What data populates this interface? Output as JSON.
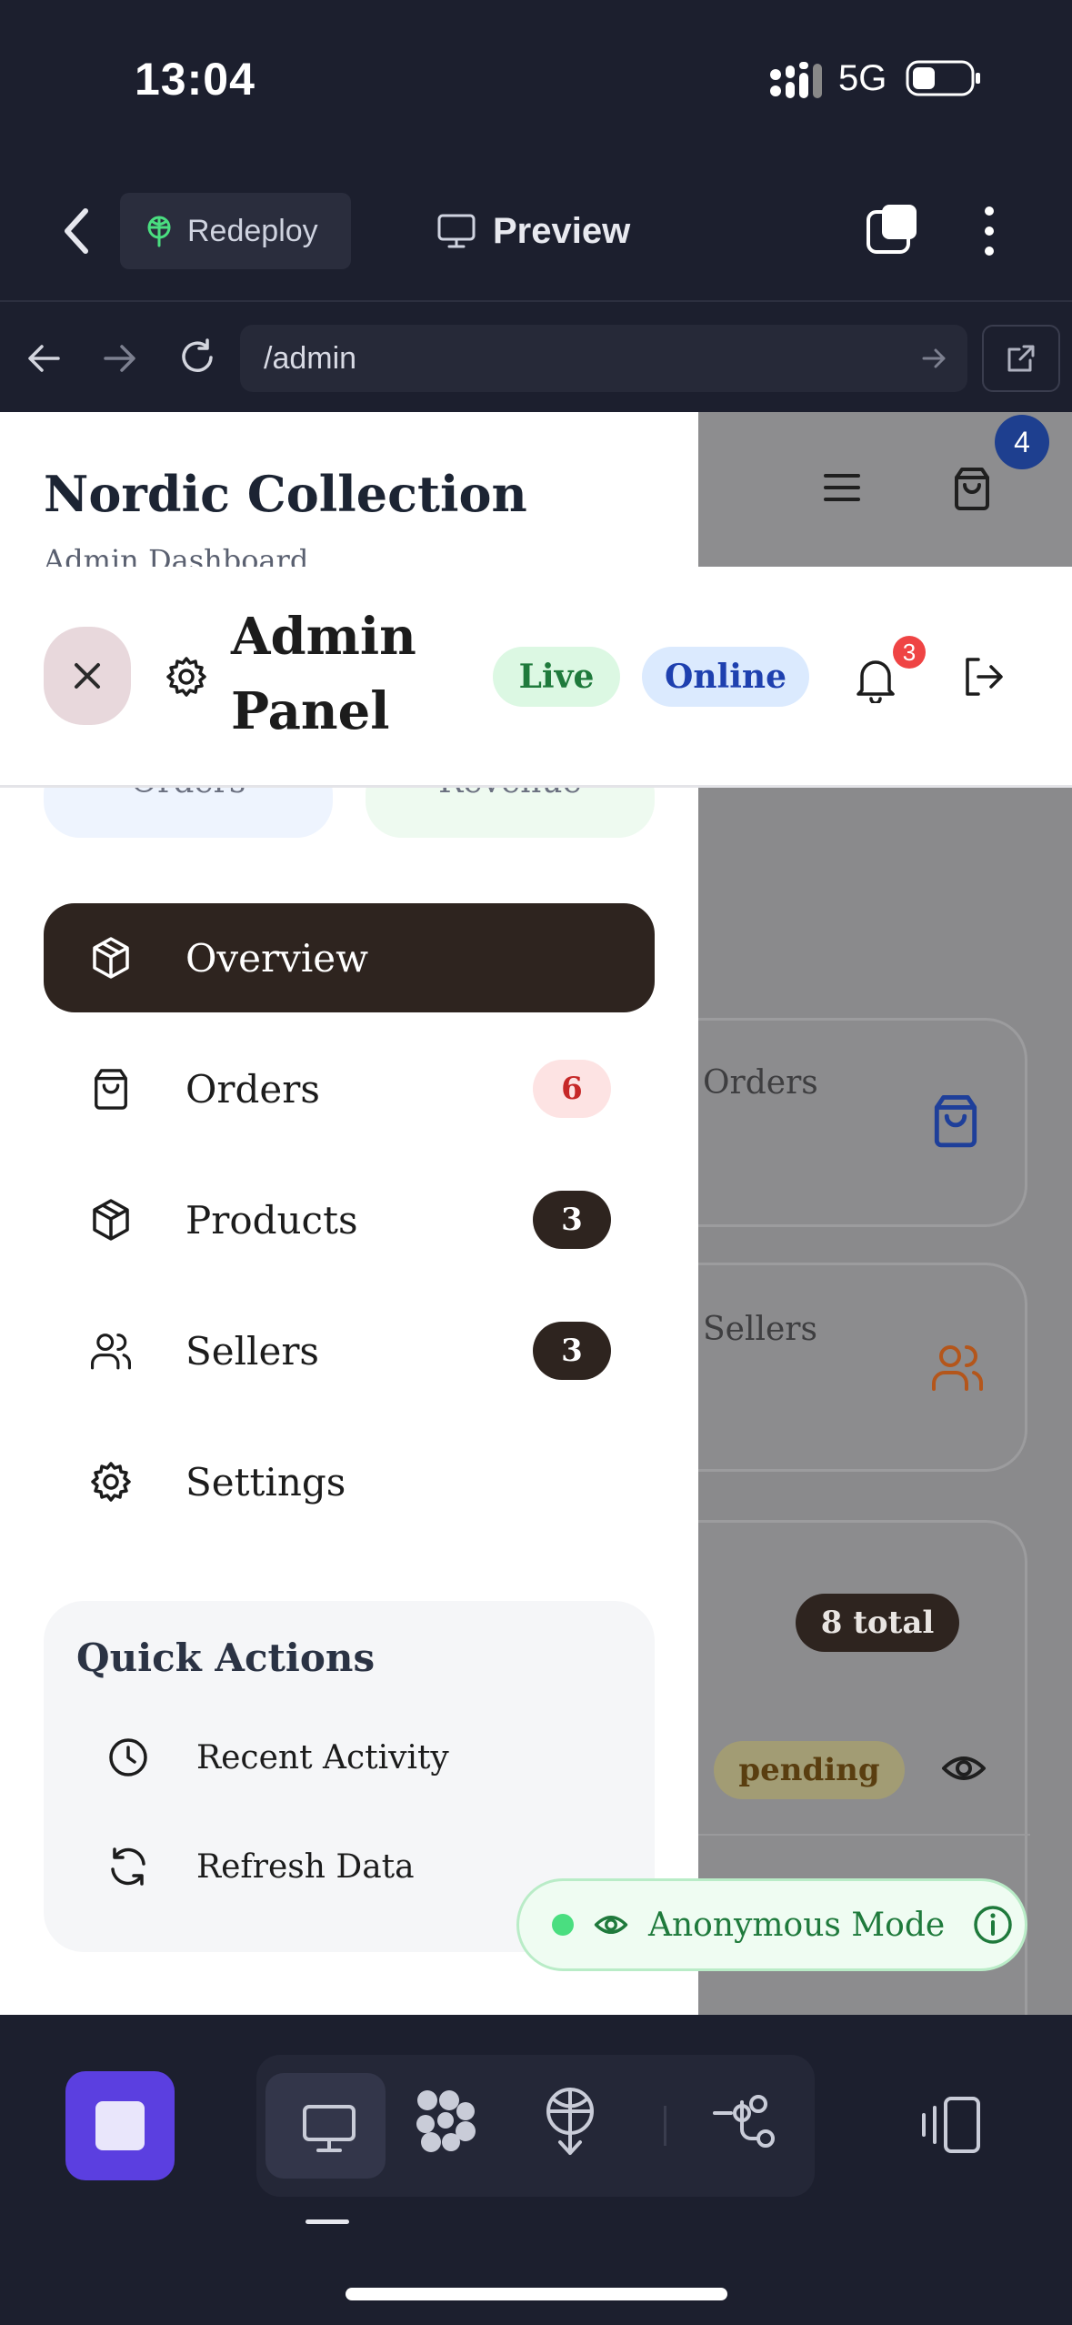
{
  "status_bar": {
    "time": "13:04",
    "network": "5G"
  },
  "toolbar": {
    "redeploy_label": "Redeploy",
    "preview_label": "Preview"
  },
  "browser": {
    "url": "/admin"
  },
  "background": {
    "cart_badge": "4",
    "card_orders_label": "Orders",
    "card_sellers_label": "Sellers",
    "total_pill": "8 total",
    "status_pill": "pending"
  },
  "sidebar": {
    "brand_title": "Nordic Collection",
    "brand_subtitle": "Admin Dashboard",
    "stat_orders": "Orders",
    "stat_revenue": "Revenue",
    "nav": [
      {
        "label": "Overview",
        "icon": "box-icon",
        "badge": ""
      },
      {
        "label": "Orders",
        "icon": "shopping-bag-icon",
        "badge": "6"
      },
      {
        "label": "Products",
        "icon": "box-icon",
        "badge": "3"
      },
      {
        "label": "Sellers",
        "icon": "users-icon",
        "badge": "3"
      },
      {
        "label": "Settings",
        "icon": "gear-icon",
        "badge": ""
      }
    ],
    "quick_actions": {
      "title": "Quick Actions",
      "items": [
        {
          "label": "Recent Activity",
          "icon": "clock-icon"
        },
        {
          "label": "Refresh Data",
          "icon": "refresh-icon"
        }
      ]
    }
  },
  "admin_header": {
    "title_line1": "Admin",
    "title_line2": "Panel",
    "live_tag": "Live",
    "online_tag": "Online",
    "notification_count": "3"
  },
  "anonymous_toast": {
    "label": "Anonymous Mode"
  },
  "colors": {
    "overview_active_bg": "#2e241f",
    "live_green": "#1f7a3c",
    "online_blue": "#1e40af",
    "danger_badge_bg": "#fde3e3",
    "danger_badge_text": "#c62828",
    "stop_button": "#5b3fe0"
  }
}
